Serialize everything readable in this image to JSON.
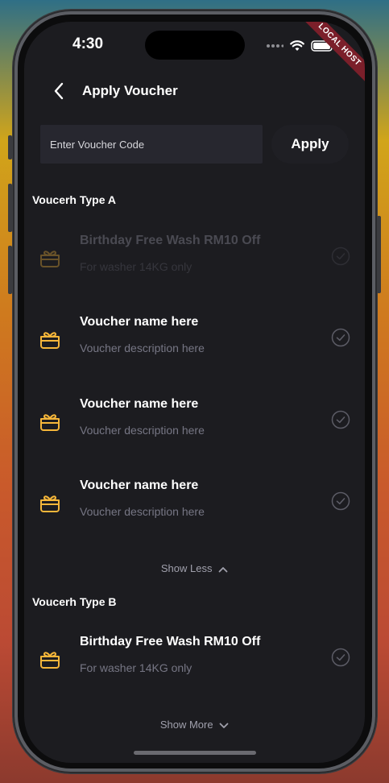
{
  "status_bar": {
    "time": "4:30",
    "debug_banner": "LOCAL HOST"
  },
  "header": {
    "title": "Apply Voucher"
  },
  "voucher_code": {
    "placeholder": "Enter Voucher Code",
    "value": "",
    "apply_label": "Apply"
  },
  "sections": [
    {
      "title": "Voucerh Type A",
      "items": [
        {
          "name": "Birthday Free Wash RM10 Off",
          "description": "For washer 14KG only",
          "disabled": true
        },
        {
          "name": "Voucher name here",
          "description": "Voucher description here",
          "disabled": false
        },
        {
          "name": "Voucher name here",
          "description": "Voucher description here",
          "disabled": false
        },
        {
          "name": "Voucher name here",
          "description": "Voucher description here",
          "disabled": false
        }
      ],
      "toggle_label": "Show Less"
    },
    {
      "title": "Voucerh Type B",
      "items": [
        {
          "name": "Birthday Free Wash RM10 Off",
          "description": "For washer 14KG only",
          "disabled": false
        }
      ],
      "toggle_label": "Show More"
    }
  ],
  "colors": {
    "background": "#1c1c20",
    "input_bg": "#27272f",
    "gift_icon": "#f5b63a",
    "muted_text": "#767684",
    "banner": "#7b1f2a"
  },
  "icons": {
    "back": "chevron-left-icon",
    "voucher": "gift-icon",
    "select": "check-circle-icon",
    "collapse": "chevron-up-icon",
    "expand": "chevron-down-icon"
  }
}
